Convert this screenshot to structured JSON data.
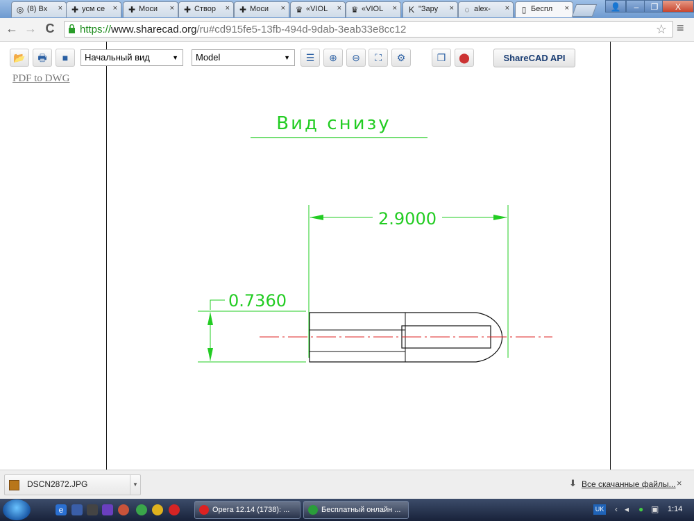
{
  "browser": {
    "tabs": [
      {
        "label": "(8) Вх",
        "icon": "mail-icon"
      },
      {
        "label": "усм се",
        "icon": "cross-icon"
      },
      {
        "label": "Моси",
        "icon": "cross-icon"
      },
      {
        "label": "Створ",
        "icon": "cross-icon"
      },
      {
        "label": "Моси",
        "icon": "cross-icon"
      },
      {
        "label": "«VIOL",
        "icon": "crown-icon"
      },
      {
        "label": "«VIOL",
        "icon": "crown-icon"
      },
      {
        "label": "\"Зару",
        "icon": "k-logo-icon"
      },
      {
        "label": "alex-",
        "icon": "globe-icon"
      },
      {
        "label": "Беспл",
        "icon": "page-icon"
      }
    ],
    "close_glyph": "×",
    "window_buttons": {
      "user": "👤",
      "minimize": "–",
      "restore": "❐",
      "close": "X"
    },
    "nav": {
      "back": "←",
      "forward": "→",
      "reload": "C"
    },
    "url": {
      "scheme": "https://",
      "host": "www.sharecad.org",
      "path": "/ru#cd915fe5-13fb-494d-9dab-3eab33e8cc12"
    },
    "star": "☆",
    "menu": "≡"
  },
  "toolbar": {
    "view_select": "Начальный вид",
    "layout_select": "Model",
    "api_button": "ShareCAD API",
    "pdf_link": "PDF to DWG"
  },
  "drawing": {
    "title": "Вид снизу",
    "dim_length": "2.9000",
    "dim_diameter": "0.7360",
    "colors": {
      "dimension": "#22cc22",
      "centerline": "#dd2222",
      "outline": "#111111"
    }
  },
  "downloads": {
    "file_name": "DSCN2872.JPG",
    "show_all": "Все скачанные файлы...",
    "close": "×"
  },
  "taskbar": {
    "tasks": [
      {
        "label": "Opera 12.14 (1738): ...",
        "color": "#d22"
      },
      {
        "label": "Бесплатный онлайн ...",
        "color": "#2a9d3a"
      }
    ],
    "lang": "UK",
    "clock": "1:14"
  }
}
